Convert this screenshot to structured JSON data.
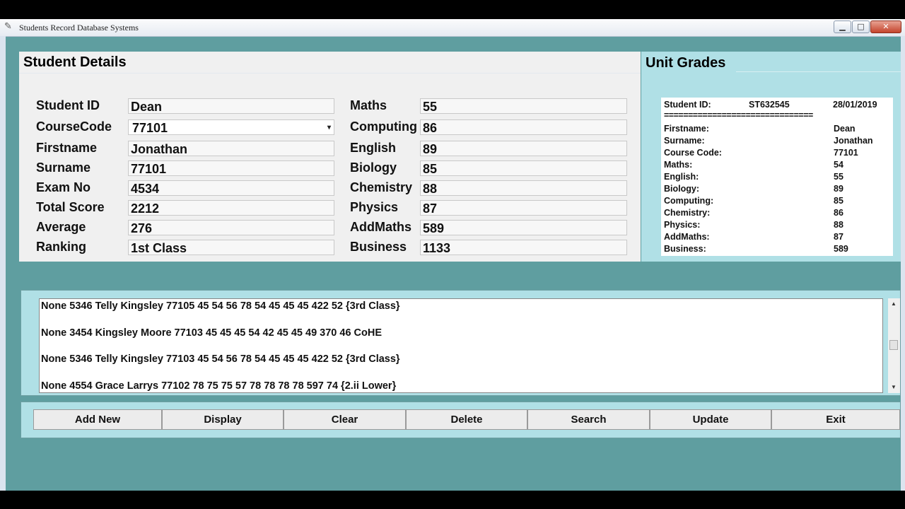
{
  "window": {
    "title": "Students Record Database Systems",
    "icon": "feather-icon",
    "controls": {
      "minimize": "▁",
      "maximize": "□",
      "close": "✕"
    }
  },
  "student_details": {
    "title": "Student Details",
    "left_fields": [
      {
        "label": "Student ID",
        "value": "Dean"
      },
      {
        "label": "CourseCode",
        "value": "77101"
      },
      {
        "label": "Firstname",
        "value": "Jonathan"
      },
      {
        "label": "Surname",
        "value": "77101"
      },
      {
        "label": "Exam No",
        "value": "4534"
      },
      {
        "label": "Total Score",
        "value": "2212"
      },
      {
        "label": "Average",
        "value": "276"
      },
      {
        "label": "Ranking",
        "value": "1st Class"
      }
    ],
    "right_fields": [
      {
        "label": "Maths",
        "value": "55"
      },
      {
        "label": "Computing",
        "value": "86"
      },
      {
        "label": "English",
        "value": "89"
      },
      {
        "label": "Biology",
        "value": "85"
      },
      {
        "label": "Chemistry",
        "value": "88"
      },
      {
        "label": "Physics",
        "value": "87"
      },
      {
        "label": "AddMaths",
        "value": "589"
      },
      {
        "label": "Business",
        "value": "1133"
      }
    ]
  },
  "unit_grades": {
    "title": "Unit Grades",
    "header": {
      "label": "Student ID:",
      "id": "ST632545",
      "date": "28/01/2019"
    },
    "separator": "===============================",
    "rows": [
      {
        "label": "Firstname:",
        "value": "Dean"
      },
      {
        "label": "Surname:",
        "value": "Jonathan"
      },
      {
        "label": "Course Code:",
        "value": "77101"
      },
      {
        "label": "Maths:",
        "value": "54"
      },
      {
        "label": "English:",
        "value": "55"
      },
      {
        "label": "Biology:",
        "value": "89"
      },
      {
        "label": "Computing:",
        "value": "85"
      },
      {
        "label": "Chemistry:",
        "value": "86"
      },
      {
        "label": "Physics:",
        "value": "88"
      },
      {
        "label": "AddMaths:",
        "value": "87"
      },
      {
        "label": "Business:",
        "value": "589"
      }
    ]
  },
  "records_list": [
    "None 5346 Telly Kingsley 77105 45 54 56 78 54 45 45 45 422 52 {3rd Class}",
    "None 3454 Kingsley Moore 77103 45 45 45 54 42 45 45 49 370 46 CoHE",
    "None 5346 Telly Kingsley 77103 45 54 56 78 54 45 45 45 422 52 {3rd Class}",
    "None 4554 Grace Larrys 77102 78 75 75 57 78 78 78 78 597 74 {2.ii Lower}"
  ],
  "scrollbar": {
    "up": "▲",
    "down": "▼"
  },
  "buttons": [
    "Add New",
    "Display",
    "Clear",
    "Delete",
    "Search",
    "Update",
    "Exit"
  ],
  "colors": {
    "background": "#5f9ea0",
    "panel": "#b0e0e6",
    "form": "#f0f0f0"
  }
}
